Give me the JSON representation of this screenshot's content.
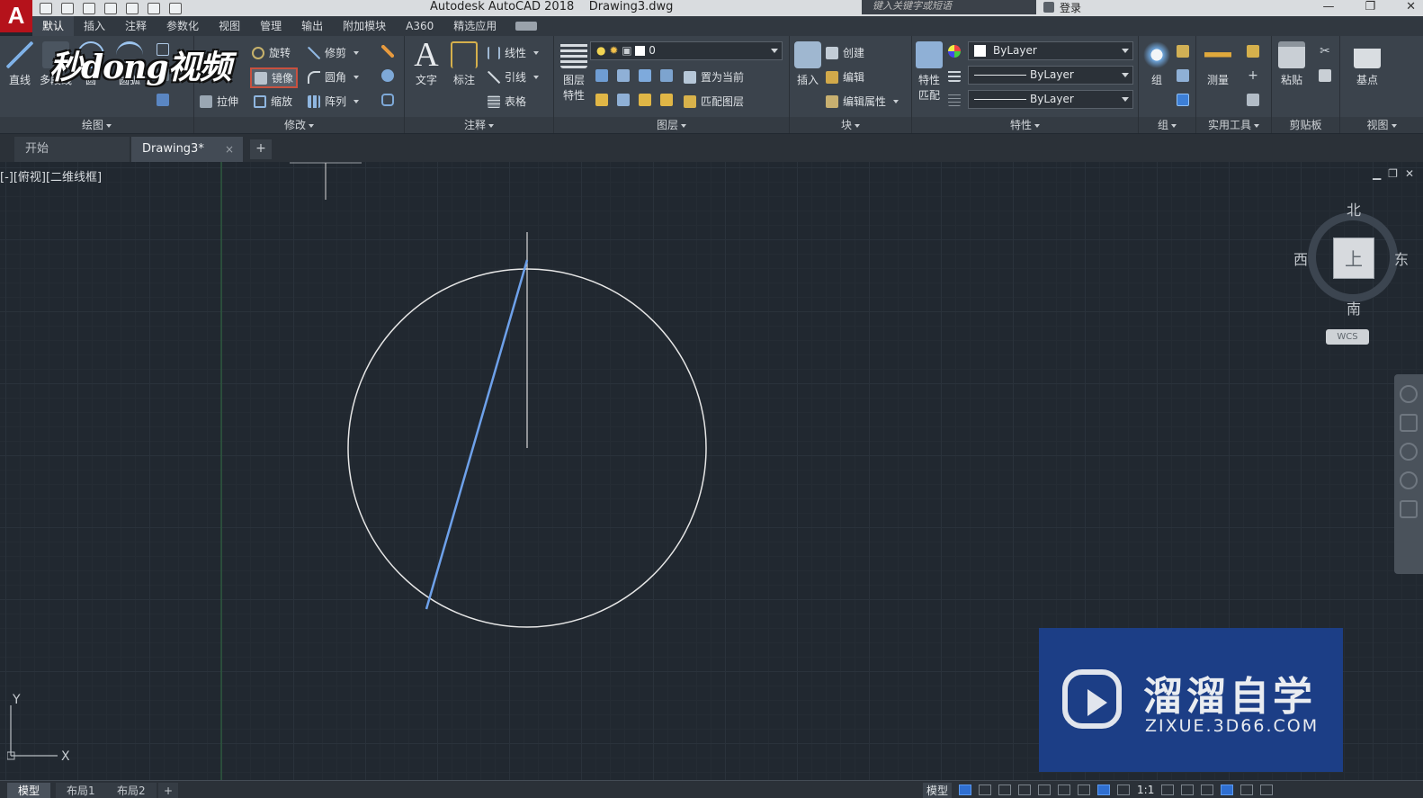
{
  "app": {
    "logo_letter": "A",
    "title": "Autodesk AutoCAD 2018",
    "filename": "Drawing3.dwg",
    "search_placeholder": "键入关键字或短语",
    "login": "登录",
    "window_controls": [
      "—",
      "❐",
      "✕"
    ]
  },
  "menu_tabs": [
    "默认",
    "插入",
    "注释",
    "参数化",
    "视图",
    "管理",
    "输出",
    "附加模块",
    "A360",
    "精选应用"
  ],
  "active_menu_tab": "默认",
  "watermark_logo": "秒dong视频",
  "ribbon": {
    "draw": {
      "title": "绘图",
      "line": "直线",
      "polyline": "多段线",
      "circle": "圆",
      "arc": "圆弧"
    },
    "modify": {
      "title": "修改",
      "rotate": "旋转",
      "trim": "修剪",
      "mirror": "镜像",
      "fillet": "圆角",
      "stretch": "拉伸",
      "scale": "缩放",
      "array": "阵列"
    },
    "annotation": {
      "title": "注释",
      "text": "文字",
      "dimension": "标注",
      "linear": "线性",
      "leader": "引线",
      "table": "表格"
    },
    "layers": {
      "title": "图层",
      "layer_props_line1": "图层",
      "layer_props_line2": "特性",
      "current_layer": "0",
      "set_current": "置为当前",
      "match_layer": "匹配图层"
    },
    "block": {
      "title": "块",
      "insert": "插入",
      "create": "创建",
      "edit": "编辑",
      "edit_attributes": "编辑属性"
    },
    "properties": {
      "title": "特性",
      "match_line1": "特性",
      "match_line2": "匹配",
      "color": "ByLayer",
      "linetype": "ByLayer",
      "lineweight": "ByLayer"
    },
    "groups": {
      "title": "组",
      "group": "组"
    },
    "utilities": {
      "title": "实用工具",
      "measure": "测量"
    },
    "clipboard": {
      "title": "剪贴板",
      "paste": "粘贴"
    },
    "view": {
      "title": "视图",
      "base": "基点"
    }
  },
  "doc_tabs": {
    "start": "开始",
    "drawing": "Drawing3*",
    "close": "×",
    "add": "+"
  },
  "viewport": {
    "label": "[-][俯视][二维线框]",
    "controls": [
      "▁",
      "❐",
      "✕"
    ]
  },
  "viewcube": {
    "north": "北",
    "south": "南",
    "east": "东",
    "west": "西",
    "face": "上",
    "wcs": "WCS"
  },
  "ucs": {
    "x": "X",
    "y": "Y"
  },
  "watermark": {
    "name": "溜溜自学",
    "url": "ZIXUE.3D66.COM"
  },
  "statusbar": {
    "layouts": [
      "模型",
      "布局1",
      "布局2"
    ],
    "add": "+",
    "model_button": "模型",
    "scale": "1:1"
  },
  "colors": {
    "canvas": "#212830",
    "circle": "#e6e6e6",
    "selected_line": "#6ea1ea",
    "crosshair": "#d9d9d9",
    "y_axis": "#2f6b3f"
  }
}
